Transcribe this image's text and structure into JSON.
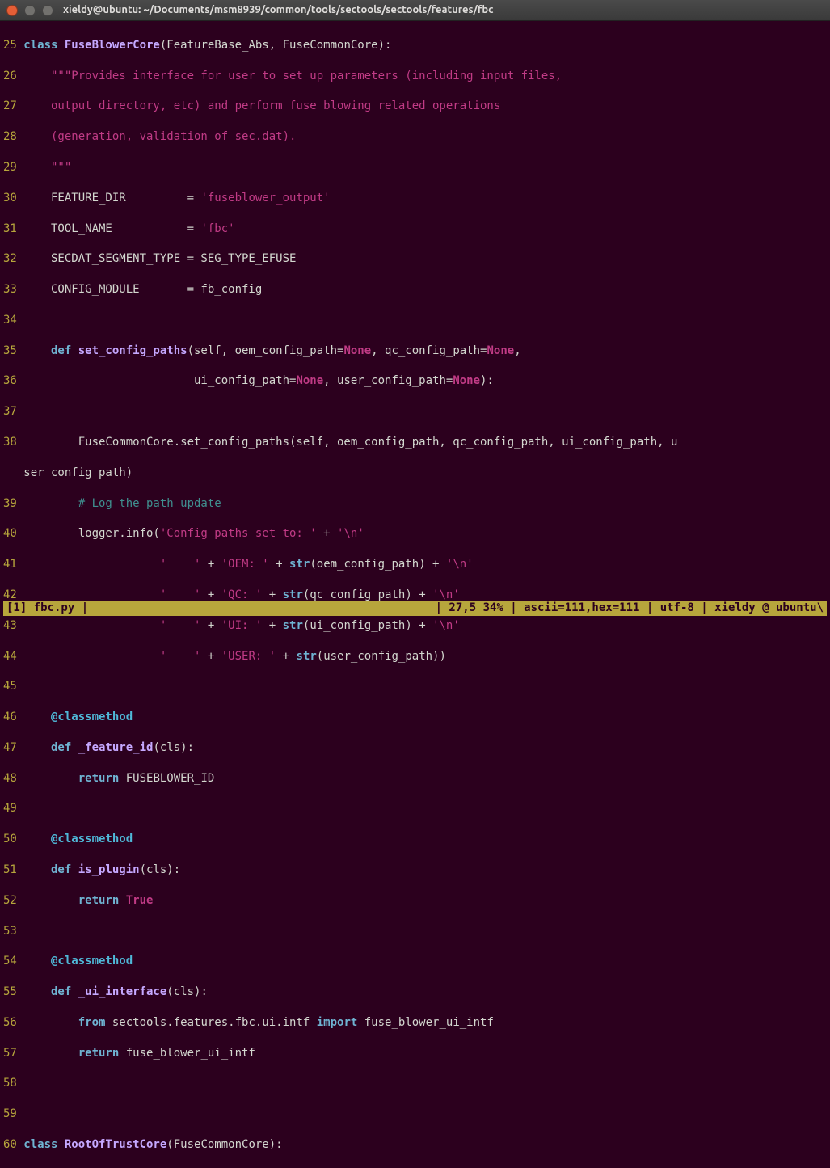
{
  "window": {
    "title": "xieldy@ubuntu: ~/Documents/msm8939/common/tools/sectools/sectools/features/fbc"
  },
  "gutter": {
    "start": 25,
    "end": 60
  },
  "code": {
    "l25": {
      "kw": "class ",
      "name": "FuseBlowerCore",
      "rest": "(FeatureBase_Abs, FuseCommonCore):"
    },
    "l26": "    \"\"\"Provides interface for user to set up parameters (including input files,",
    "l27": "    output directory, etc) and perform fuse blowing related operations",
    "l28": "    (generation, validation of sec.dat).",
    "l29": "    \"\"\"",
    "l30": {
      "lhs": "    FEATURE_DIR         = ",
      "str": "'fuseblower_output'"
    },
    "l31": {
      "lhs": "    TOOL_NAME           = ",
      "str": "'fbc'"
    },
    "l32": "    SECDAT_SEGMENT_TYPE = SEG_TYPE_EFUSE",
    "l33": "    CONFIG_MODULE       = fb_config",
    "l34": "",
    "l35": {
      "indent": "    ",
      "kw": "def ",
      "name": "set_config_paths",
      "args1": "(self, oem_config_path=",
      "none1": "None",
      "args2": ", qc_config_path=",
      "none2": "None",
      "args3": ","
    },
    "l36": {
      "indent": "                         ",
      "args1": "ui_config_path=",
      "none1": "None",
      "args2": ", user_config_path=",
      "none2": "None",
      "args3": "):"
    },
    "l37": "",
    "l38": "        FuseCommonCore.set_config_paths(self, oem_config_path, qc_config_path, ui_config_path, u",
    "l38wrap": "ser_config_path)",
    "l39": {
      "indent": "        ",
      "comment": "# Log the path update"
    },
    "l40": {
      "indent": "        logger.info(",
      "s1": "'Config paths set to: '",
      "plus": " + ",
      "s2": "'\\n'"
    },
    "l41": {
      "indent": "                    ",
      "s1": "'    '",
      "plus1": " + ",
      "s2": "'OEM: '",
      "plus2": " + ",
      "fn": "str",
      "args": "(oem_config_path) + ",
      "s3": "'\\n'"
    },
    "l42": {
      "indent": "                    ",
      "s1": "'    '",
      "plus1": " + ",
      "s2": "'QC: '",
      "plus2": " + ",
      "fn": "str",
      "args": "(qc_config_path) + ",
      "s3": "'\\n'"
    },
    "l43": {
      "indent": "                    ",
      "s1": "'    '",
      "plus1": " + ",
      "s2": "'UI: '",
      "plus2": " + ",
      "fn": "str",
      "args": "(ui_config_path) + ",
      "s3": "'\\n'"
    },
    "l44": {
      "indent": "                    ",
      "s1": "'    '",
      "plus1": " + ",
      "s2": "'USER: '",
      "plus2": " + ",
      "fn": "str",
      "args": "(user_config_path))"
    },
    "l45": "",
    "l46": {
      "indent": "    ",
      "dec": "@classmethod"
    },
    "l47": {
      "indent": "    ",
      "kw": "def ",
      "name": "_feature_id",
      "args": "(cls):"
    },
    "l48": {
      "indent": "        ",
      "kw": "return",
      "rest": " FUSEBLOWER_ID"
    },
    "l49": "",
    "l50": {
      "indent": "    ",
      "dec": "@classmethod"
    },
    "l51": {
      "indent": "    ",
      "kw": "def ",
      "name": "is_plugin",
      "args": "(cls):"
    },
    "l52": {
      "indent": "        ",
      "kw": "return ",
      "const": "True"
    },
    "l53": "",
    "l54": {
      "indent": "    ",
      "dec": "@classmethod"
    },
    "l55": {
      "indent": "    ",
      "kw": "def ",
      "name": "_ui_interface",
      "args": "(cls):"
    },
    "l56": {
      "indent": "        ",
      "kw1": "from",
      "mid": " sectools.features.fbc.ui.intf ",
      "kw2": "import",
      "rest": " fuse_blower_ui_intf"
    },
    "l57": {
      "indent": "        ",
      "kw": "return",
      "rest": " fuse_blower_ui_intf"
    },
    "l58": "",
    "l59": "",
    "l60": {
      "kw": "class ",
      "name": "RootOfTrustCore",
      "rest": "(FuseCommonCore):"
    }
  },
  "statusbar": {
    "left": "[1] fbc.py |",
    "right": "| 27,5 34% | ascii=111,hex=111 | utf-8 | xieldy @ ubuntu\\"
  }
}
